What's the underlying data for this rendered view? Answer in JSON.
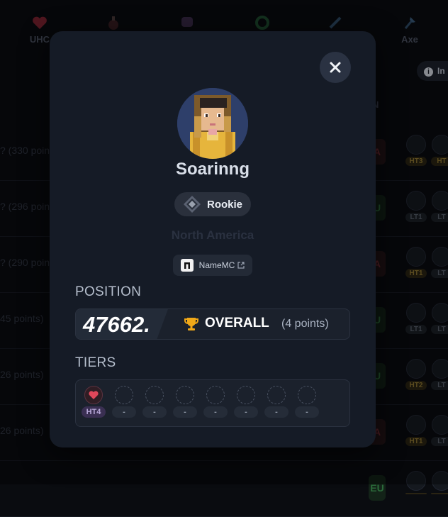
{
  "background": {
    "tabs": [
      {
        "label": "UHC",
        "icon": "heart-icon"
      },
      {
        "label": "",
        "icon": "potion-icon"
      },
      {
        "label": "",
        "icon": "netherite-helmet-icon"
      },
      {
        "label": "",
        "icon": "shield-icon"
      },
      {
        "label": "",
        "icon": "sword-icon"
      },
      {
        "label": "Axe",
        "icon": "axe-icon"
      }
    ],
    "info_button": "In",
    "column_header": "N",
    "rows": [
      {
        "points": "? (330 points)",
        "region": "A",
        "tiers": [
          "HT3",
          "HT"
        ]
      },
      {
        "points": "? (296 points)",
        "region": "U",
        "tiers": [
          "LT1",
          "LT"
        ]
      },
      {
        "points": "? (290 points)",
        "region": "A",
        "tiers": [
          "HT1",
          "LT"
        ]
      },
      {
        "points": "45 points)",
        "region": "U",
        "tiers": [
          "LT1",
          "LT"
        ]
      },
      {
        "points": "26 points)",
        "region": "U",
        "tiers": [
          "HT2",
          "LT"
        ]
      },
      {
        "points": "26 points)",
        "region": "A",
        "tiers": [
          "HT1",
          "LT"
        ]
      },
      {
        "points": "",
        "region": "EU",
        "tiers": [
          "",
          ""
        ]
      }
    ]
  },
  "modal": {
    "close_icon": "close-icon",
    "player_name": "Soarinng",
    "rank": "Rookie",
    "region": "North America",
    "namemc_label": "NameMC",
    "position_title": "POSITION",
    "position_number": "47662.",
    "position_label": "OVERALL",
    "position_points": "(4 points)",
    "tiers_title": "TIERS",
    "tiers": [
      {
        "label": "HT4",
        "icon": "heart-icon",
        "filled": true
      },
      {
        "label": "-",
        "filled": false
      },
      {
        "label": "-",
        "filled": false
      },
      {
        "label": "-",
        "filled": false
      },
      {
        "label": "-",
        "filled": false
      },
      {
        "label": "-",
        "filled": false
      },
      {
        "label": "-",
        "filled": false
      },
      {
        "label": "-",
        "filled": false
      }
    ],
    "colors": {
      "ht4": "#b7a7d8",
      "trophy": "#f0a818",
      "avatar_bg": "#2e3f6a"
    }
  }
}
